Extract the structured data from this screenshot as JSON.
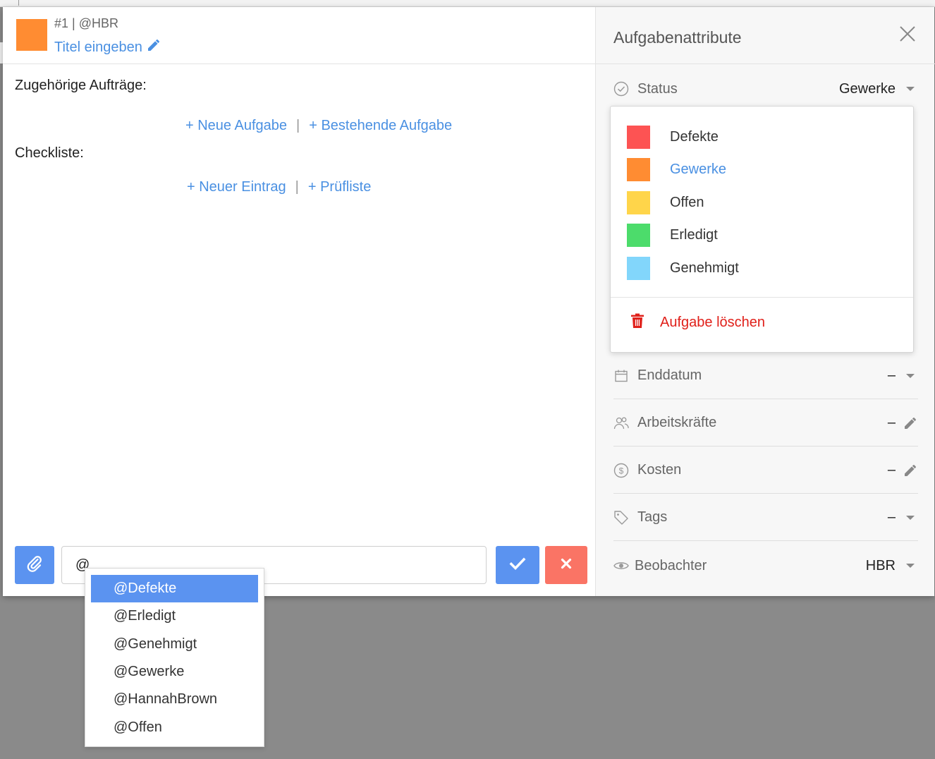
{
  "task": {
    "id_line": "#1 | @HBR",
    "title_placeholder": "Titel eingeben",
    "color": "#ff8c32"
  },
  "sections": {
    "related_label": "Zugehörige Aufträge:",
    "new_task": "+ Neue Aufgabe",
    "existing_task": "+ Bestehende Aufgabe",
    "checklist_label": "Checkliste:",
    "new_entry": "+ Neuer Eintrag",
    "checklist_template": "+ Prüfliste",
    "separator": "|"
  },
  "comment": {
    "value": "@"
  },
  "mentions": [
    "@Defekte",
    "@Erledigt",
    "@Genehmigt",
    "@Gewerke",
    "@HannahBrown",
    "@Offen"
  ],
  "attributes": {
    "title": "Aufgabenattribute",
    "status_label": "Status",
    "status_value": "Gewerke",
    "end_date_label": "Enddatum",
    "end_date_value": "–",
    "workers_label": "Arbeitskräfte",
    "workers_value": "–",
    "cost_label": "Kosten",
    "cost_value": "–",
    "tags_label": "Tags",
    "tags_value": "–",
    "watchers_label": "Beobachter",
    "watchers_value": "HBR"
  },
  "status_options": [
    {
      "name": "Defekte",
      "color": "#fd5353"
    },
    {
      "name": "Gewerke",
      "color": "#ff8c32"
    },
    {
      "name": "Offen",
      "color": "#ffd54a"
    },
    {
      "name": "Erledigt",
      "color": "#4cdc6b"
    },
    {
      "name": "Genehmigt",
      "color": "#82d6fb"
    }
  ],
  "status_selected": "Gewerke",
  "delete_label": "Aufgabe löschen",
  "colors": {
    "accent": "#5b93f0",
    "link": "#4a90e2",
    "danger": "#e0201a",
    "cancel": "#fa7465"
  }
}
